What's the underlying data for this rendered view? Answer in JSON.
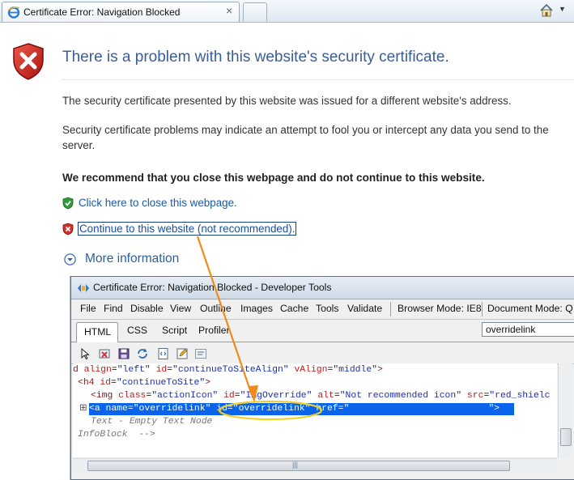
{
  "browser": {
    "tab_title": "Certificate Error: Navigation Blocked",
    "tab_close_glyph": "×",
    "icons": {
      "tab": "ie-logo-icon",
      "home": "home-icon",
      "home_dropdown": "chevron-down-icon"
    },
    "home_dropdown_glyph": "▼"
  },
  "page": {
    "heading": "There is a problem with this website's security certificate.",
    "paragraph1": "The security certificate presented by this website was issued for a different website's address.",
    "paragraph2": "Security certificate problems may indicate an attempt to fool you or intercept any data you send to the server.",
    "recommendation": "We recommend that you close this webpage and do not continue to this website.",
    "close_link": "Click here to close this webpage.",
    "continue_link": "Continue to this website (not recommended).",
    "more_info": "More information",
    "icons": {
      "header": "red-shield-x-icon",
      "close": "green-shield-check-icon",
      "continue": "red-shield-x-icon",
      "more": "expand-circle-icon"
    },
    "colors": {
      "heading": "#3a5e94",
      "link": "#1a5aa7",
      "highlight": "#0a64ea",
      "annotation": "#f08a1a"
    }
  },
  "devtools": {
    "title": "Certificate Error: Navigation Blocked - Developer Tools",
    "menu": [
      "File",
      "Find",
      "Disable",
      "View",
      "Outline",
      "Images",
      "Cache",
      "Tools",
      "Validate",
      "Browser Mode: IE8",
      "Document Mode: Q"
    ],
    "tabs": [
      "HTML",
      "CSS",
      "Script",
      "Profiler"
    ],
    "active_tab": "HTML",
    "search_value": "overridelink",
    "toolbar_icons": [
      "select-element-icon",
      "clear-browser-cache-icon",
      "save-icon",
      "refresh-icon",
      "view-source-icon",
      "edit-icon",
      "word-wrap-icon"
    ],
    "code": {
      "line1": {
        "prefix": "d ",
        "attr1": "align",
        "val1": "\"left\"",
        "attr2": "id",
        "val2": "\"continueToSiteAlign\"",
        "attr3": "vAlign",
        "val3": "\"middle\"",
        "suffix": ">"
      },
      "line2": {
        "open": "<h4 ",
        "attr": "id",
        "val": "\"continueToSite\"",
        "close": ">"
      },
      "line3": {
        "open": "<img ",
        "attr1": "class",
        "val1": "\"actionIcon\"",
        "attr2": "id",
        "val2": "\"ImgOverride\"",
        "attr3": "alt",
        "val3": "\"Not recommended icon\"",
        "attr4": "src",
        "val4": "\"red_shielc"
      },
      "line4": {
        "open": "<a ",
        "attr1": "name",
        "val1": "\"overridelink\"",
        "attr2": "id",
        "val2": "\"overridelink\"",
        "attr3": "href",
        "val3": "\"",
        "close": "\">"
      },
      "line5": "Text - Empty Text Node",
      "line6": "InfoBlock  -->",
      "expand_glyph": "⊞"
    },
    "scroll_grip": "|||"
  }
}
